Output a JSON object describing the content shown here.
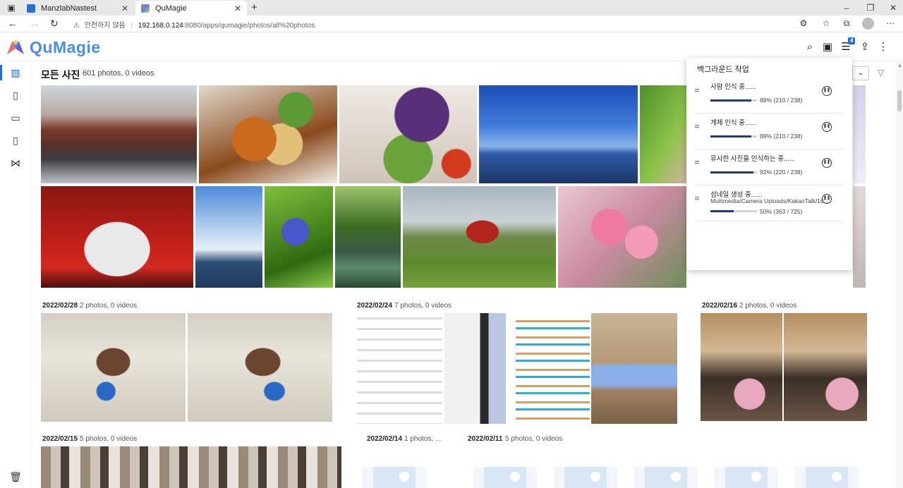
{
  "browser": {
    "tabs": [
      {
        "label": "ManzlabNastest",
        "active": false
      },
      {
        "label": "QuMagie",
        "active": true
      }
    ],
    "not_secure": "안전하지 않음",
    "url_host": "192.168.0.124",
    "url_path": ":8080/apps/qumagie/photos/all%20photos"
  },
  "app": {
    "logo": "QuMagie",
    "notification_count": "4"
  },
  "page": {
    "title": "모든 사진",
    "count": "601 photos, 0 videos"
  },
  "groups": [
    {
      "date": "2022/02/28",
      "count": "2 photos, 0 videos"
    },
    {
      "date": "2022/02/24",
      "count": "7 photos, 0 videos"
    },
    {
      "date": "2022/02/16",
      "count": "2 photos, 0 videos"
    },
    {
      "date": "2022/02/15",
      "count": "5 photos, 0 videos"
    },
    {
      "date": "2022/02/14",
      "count": "1 photos, ..."
    },
    {
      "date": "2022/02/11",
      "count": "5 photos, 0 videos"
    }
  ],
  "background_tasks": {
    "title": "백그라운드 작업",
    "tasks": [
      {
        "name": "사람 인식 중......",
        "subtitle": "",
        "progress": "88% (210 / 238)",
        "percent": 88
      },
      {
        "name": "개체 인식 중......",
        "subtitle": "",
        "progress": "88% (210 / 238)",
        "percent": 88
      },
      {
        "name": "유사한 사진을 인식하는 중......",
        "subtitle": "",
        "progress": "92% (220 / 238)",
        "percent": 92
      },
      {
        "name": "섬네일 생성 중......",
        "subtitle": "Multimedia/Camera Uploads/KakaoTalk/16...",
        "progress": "50% (363 / 725)",
        "percent": 50
      }
    ]
  },
  "colors": {
    "accent": "#1e6fd9",
    "logo": "#4a8ee8",
    "progress_fill": "#1f3a6d"
  }
}
